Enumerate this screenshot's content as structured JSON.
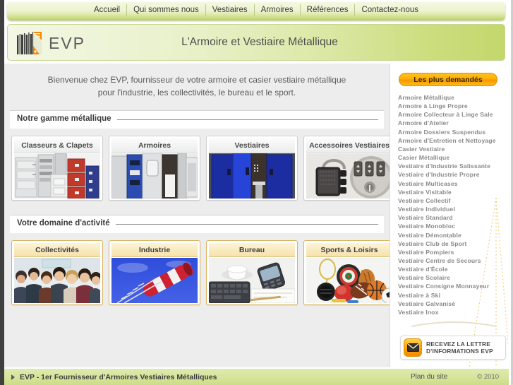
{
  "nav": {
    "items": [
      {
        "label": "Accueil",
        "name": "nav-accueil"
      },
      {
        "label": "Qui sommes nous",
        "name": "nav-qui-sommes-nous"
      },
      {
        "label": "Vestiaires",
        "name": "nav-vestiaires"
      },
      {
        "label": "Armoires",
        "name": "nav-armoires"
      },
      {
        "label": "Références",
        "name": "nav-references"
      },
      {
        "label": "Contactez-nous",
        "name": "nav-contactez-nous"
      }
    ]
  },
  "header": {
    "logo_text": "EVP",
    "logo_icon": "barcode-building-logo-icon",
    "title": "L'Armoire et Vestiaire Métallique"
  },
  "main": {
    "welcome_line1": "Bienvenue chez EVP, fournisseur de votre armoire et casier vestiaire métallique",
    "welcome_line2": "pour l'industrie, les collectivités, le bureau et le sport.",
    "section1_title": "Notre gamme métallique",
    "section2_title": "Votre domaine d'activité",
    "products": [
      {
        "label": "Classeurs & Clapets",
        "name": "card-classeurs-clapets"
      },
      {
        "label": "Armoires",
        "name": "card-armoires"
      },
      {
        "label": "Vestiaires",
        "name": "card-vestiaires"
      },
      {
        "label": "Accessoires Vestiaires",
        "name": "card-accessoires-vestiaires"
      }
    ],
    "domains": [
      {
        "label": "Collectivités",
        "name": "card-collectivites"
      },
      {
        "label": "Industrie",
        "name": "card-industrie"
      },
      {
        "label": "Bureau",
        "name": "card-bureau"
      },
      {
        "label": "Sports & Loisirs",
        "name": "card-sports-loisirs"
      }
    ]
  },
  "sidebar": {
    "promo_label": "Les plus demandés",
    "links": [
      "Armoire Métallique",
      "Armoire à Linge Propre",
      "Armoire Collecteur à Linge Sale",
      "Armoire d'Atelier",
      "Armoire Dossiers Suspendus",
      "Armoire d'Entretien et Nettoyage",
      "Casier Vestiaire",
      "Casier Métallique",
      "Vestiaire d'Industrie Salissante",
      "Vestiaire d'Industrie Propre",
      "Vestiaire Multicases",
      "Vestiaire Visitable",
      "Vestiaire Collectif",
      "Vestiaire Individuel",
      "Vestiaire Standard",
      "Vestiaire Monobloc",
      "Vestiaire Démontable",
      "Vestiaire Club de Sport",
      "Vestiaire Pompiers",
      "Vestiaire Centre de Secours",
      "Vestiaire d'École",
      "Vestiaire Scolaire",
      "Vestiaire Consigne Monnayeur",
      "Vestiaire à Ski",
      "Vestiaire Galvanisé",
      "Vestiaire Inox"
    ],
    "newsletter_icon": "envelope-icon",
    "newsletter_line1": "RECEVEZ LA LETTRE",
    "newsletter_line2": "D'INFORMATIONS EVP"
  },
  "footer": {
    "arrow_icon": "triangle-right-icon",
    "title": "EVP - 1er Fournisseur d'Armoires Vestiaires Métalliques",
    "sitemap": "Plan du site",
    "copyright": "© 2010"
  },
  "colors": {
    "nav_green": "#cfdf8c",
    "header_green": "#c3d76c",
    "accent_orange": "#ffae00",
    "footer_green": "#d6e49b",
    "panel_gray": "#ededed"
  }
}
